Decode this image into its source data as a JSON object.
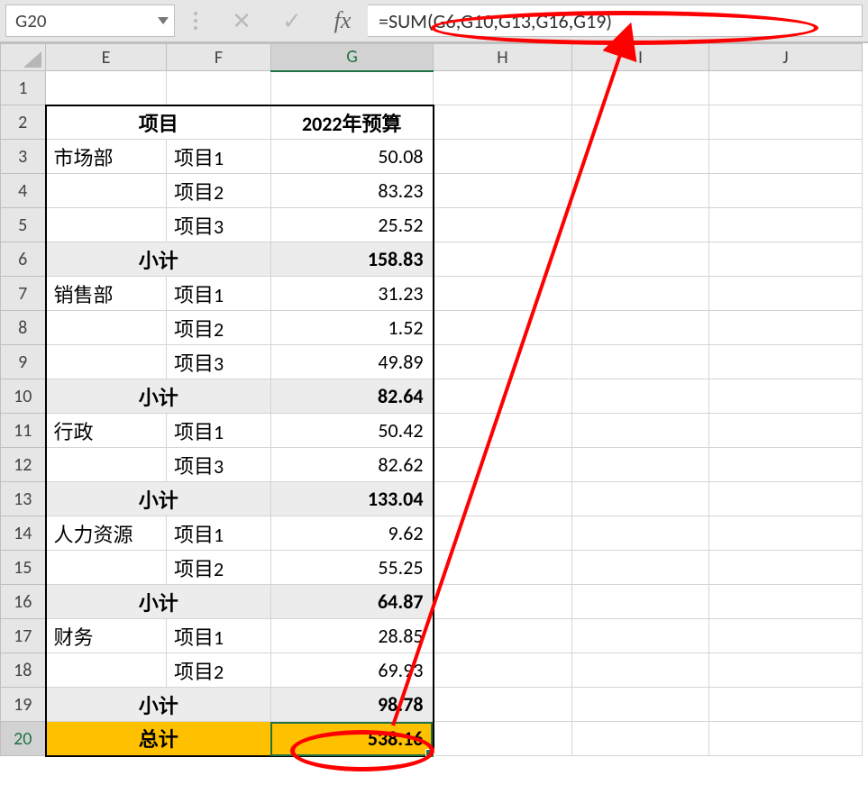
{
  "namebox": "G20",
  "formula": "=SUM(G6,G10,G13,G16,G19)",
  "columns": [
    "E",
    "F",
    "G",
    "H",
    "I",
    "J"
  ],
  "rownums": [
    "1",
    "2",
    "3",
    "4",
    "5",
    "6",
    "7",
    "8",
    "9",
    "10",
    "11",
    "12",
    "13",
    "14",
    "15",
    "16",
    "17",
    "18",
    "19",
    "20"
  ],
  "header": {
    "project": "项目",
    "budget": "2022年预算"
  },
  "rows": [
    {
      "dept": "市场部",
      "item": "项目1",
      "val": "50.08"
    },
    {
      "dept": "",
      "item": "项目2",
      "val": "83.23"
    },
    {
      "dept": "",
      "item": "项目3",
      "val": "25.52"
    },
    {
      "subtotal": "小计",
      "val": "158.83"
    },
    {
      "dept": "销售部",
      "item": "项目1",
      "val": "31.23"
    },
    {
      "dept": "",
      "item": "项目2",
      "val": "1.52"
    },
    {
      "dept": "",
      "item": "项目3",
      "val": "49.89"
    },
    {
      "subtotal": "小计",
      "val": "82.64"
    },
    {
      "dept": "行政",
      "item": "项目1",
      "val": "50.42"
    },
    {
      "dept": "",
      "item": "项目3",
      "val": "82.62"
    },
    {
      "subtotal": "小计",
      "val": "133.04"
    },
    {
      "dept": "人力资源",
      "item": "项目1",
      "val": "9.62"
    },
    {
      "dept": "",
      "item": "项目2",
      "val": "55.25"
    },
    {
      "subtotal": "小计",
      "val": "64.87"
    },
    {
      "dept": "财务",
      "item": "项目1",
      "val": "28.85"
    },
    {
      "dept": "",
      "item": "项目2",
      "val": "69.93"
    },
    {
      "subtotal": "小计",
      "val": "98.78"
    }
  ],
  "total": {
    "label": "总计",
    "val": "538.16"
  }
}
